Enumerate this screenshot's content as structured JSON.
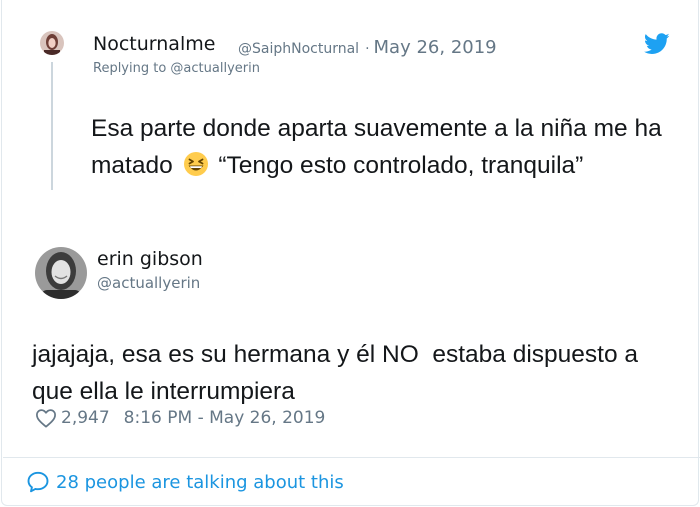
{
  "parent_tweet": {
    "display_name": "Nocturnalme",
    "handle": "@SaiphNocturnal",
    "separator": "·",
    "date": "May 26, 2019",
    "replying_to": "Replying to @actuallyerin",
    "text_before_emoji": "Esa parte donde aparta suavemente a la niña me ha matado",
    "emoji": "grinning-squinting-face",
    "text_after_emoji": "“Tengo esto controlado, tranquila”"
  },
  "tweet": {
    "display_name": "erin gibson",
    "handle": "@actuallyerin",
    "text": "jajajaja, esa es su hermana y él NO  estaba dispuesto a\nque ella le interrumpiera",
    "likes": "2,947",
    "timestamp": "8:16 PM - May 26, 2019"
  },
  "footer": {
    "conversation_label": "28 people are talking about this"
  },
  "colors": {
    "twitter_blue": "#1da1f2",
    "link_blue": "#1b95e0",
    "secondary_text": "#657786",
    "border": "#e1e8ed"
  },
  "icons": [
    "twitter-bird-icon",
    "heart-icon",
    "speech-bubble-icon",
    "grin-emoji-icon"
  ]
}
